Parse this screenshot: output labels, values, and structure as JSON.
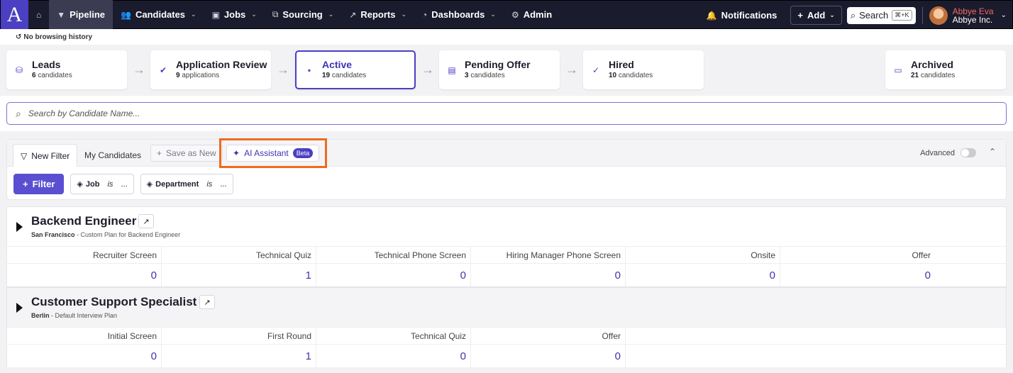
{
  "nav": {
    "logo": "A",
    "items": [
      {
        "label": "Pipeline",
        "icon": "filter-icon",
        "chevron": false,
        "active": true
      },
      {
        "label": "Candidates",
        "icon": "users-icon",
        "chevron": true
      },
      {
        "label": "Jobs",
        "icon": "briefcase-icon",
        "chevron": true
      },
      {
        "label": "Sourcing",
        "icon": "sourcing-icon",
        "chevron": true
      },
      {
        "label": "Reports",
        "icon": "chart-icon",
        "chevron": true
      },
      {
        "label": "Dashboards",
        "icon": "gauge-icon",
        "chevron": true
      },
      {
        "label": "Admin",
        "icon": "gear-icon",
        "chevron": false
      }
    ],
    "notifications": "Notifications",
    "add": "Add",
    "search": "Search",
    "search_kbd": "⌘+K",
    "user_name": "Abbye Eva",
    "user_org": "Abbye Inc."
  },
  "history": "No browsing history",
  "stages": [
    {
      "title": "Leads",
      "count": "6",
      "unit": "candidates",
      "icon": "leads-icon"
    },
    {
      "title": "Application Review",
      "count": "9",
      "unit": "applications",
      "icon": "clipboard-check-icon"
    },
    {
      "title": "Active",
      "count": "19",
      "unit": "candidates",
      "icon": "chat-icon",
      "active": true
    },
    {
      "title": "Pending Offer",
      "count": "3",
      "unit": "candidates",
      "icon": "document-icon"
    },
    {
      "title": "Hired",
      "count": "10",
      "unit": "candidates",
      "icon": "user-check-icon"
    },
    {
      "title": "Archived",
      "count": "21",
      "unit": "candidates",
      "icon": "archive-icon"
    }
  ],
  "search_placeholder": "Search by Candidate Name...",
  "filters": {
    "tab_new": "New Filter",
    "tab_mine": "My Candidates",
    "save_new": "Save as New",
    "ai_assistant": "AI Assistant",
    "beta": "Beta",
    "advanced": "Advanced",
    "filter_button": "Filter",
    "chips": [
      {
        "field": "Job",
        "op": "is",
        "value": "..."
      },
      {
        "field": "Department",
        "op": "is",
        "value": "..."
      }
    ]
  },
  "jobs": [
    {
      "title": "Backend Engineer",
      "location": "San Francisco",
      "plan": "Custom Plan for Backend Engineer",
      "stages": [
        "Recruiter Screen",
        "Technical Quiz",
        "Technical Phone Screen",
        "Hiring Manager Phone Screen",
        "Onsite",
        "Offer"
      ],
      "counts": [
        "0",
        "1",
        "0",
        "0",
        "0",
        "0"
      ]
    },
    {
      "title": "Customer Support Specialist",
      "location": "Berlin",
      "plan": "Default Interview Plan",
      "stages": [
        "Initial Screen",
        "First Round",
        "Technical Quiz",
        "Offer"
      ],
      "counts": [
        "0",
        "1",
        "0",
        "0"
      ]
    }
  ]
}
